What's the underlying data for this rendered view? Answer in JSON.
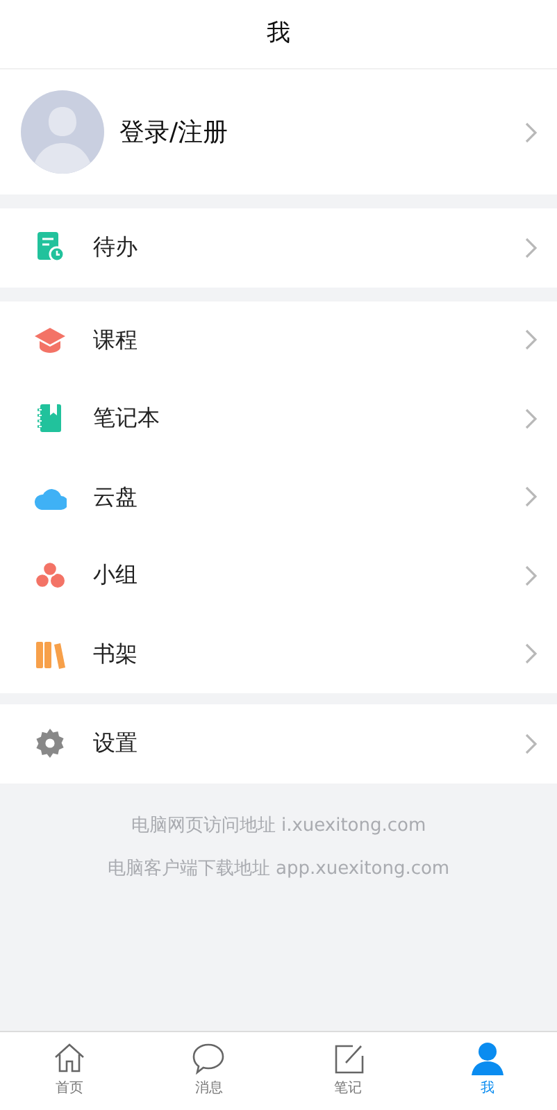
{
  "header": {
    "title": "我"
  },
  "profile": {
    "label": "登录/注册"
  },
  "menu_groups": [
    {
      "items": [
        {
          "kind": "todo",
          "label": "待办"
        }
      ]
    },
    {
      "items": [
        {
          "kind": "course",
          "label": "课程"
        },
        {
          "kind": "notebook",
          "label": "笔记本"
        },
        {
          "kind": "cloud",
          "label": "云盘"
        },
        {
          "kind": "group",
          "label": "小组"
        },
        {
          "kind": "bookshelf",
          "label": "书架"
        }
      ]
    },
    {
      "items": [
        {
          "kind": "settings",
          "label": "设置"
        }
      ]
    }
  ],
  "footer_lines": [
    "电脑网页访问地址 i.xuexitong.com",
    "电脑客户端下载地址 app.xuexitong.com"
  ],
  "tab_bar": [
    {
      "kind": "home",
      "label": "首页",
      "selected": false
    },
    {
      "kind": "message",
      "label": "消息",
      "selected": false
    },
    {
      "kind": "note",
      "label": "笔记",
      "selected": false
    },
    {
      "kind": "me",
      "label": "我",
      "selected": true
    }
  ]
}
